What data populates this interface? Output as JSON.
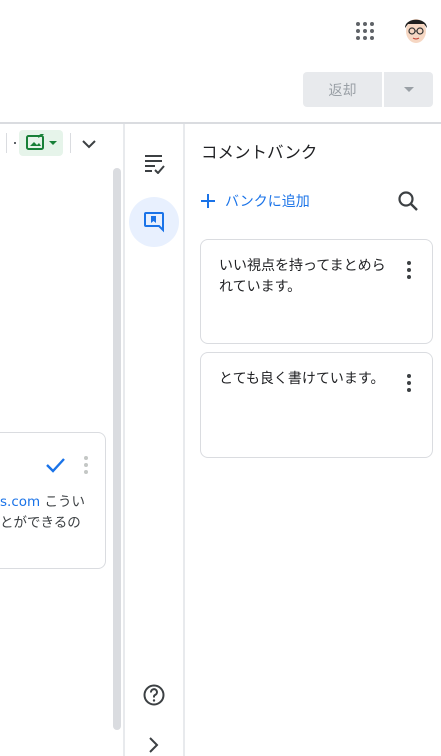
{
  "header": {
    "return_button_label": "返却"
  },
  "left_comment": {
    "link_text": "s.com",
    "line1_rest": " こうい",
    "line2": "とができるの"
  },
  "comment_bank": {
    "title": "コメントバンク",
    "add_label": "バンクに追加",
    "items": [
      {
        "text": "いい視点を持ってまとめられています。"
      },
      {
        "text": "とても良く書けています。"
      }
    ]
  },
  "colors": {
    "accent": "#1a73e8",
    "accent_light": "#e8f0fe",
    "button_disabled_bg": "#e8eaed",
    "image_button_bg": "#e6f4ea",
    "image_icon": "#188038",
    "border": "#dadce0"
  },
  "icons": [
    "apps-grid-icon",
    "avatar",
    "dropdown-arrow-icon",
    "insert-image-icon",
    "chevron-down-icon",
    "check-icon",
    "more-vert-icon",
    "list-check-icon",
    "comment-bank-icon",
    "help-icon",
    "expand-icon",
    "plus-icon",
    "search-icon"
  ]
}
